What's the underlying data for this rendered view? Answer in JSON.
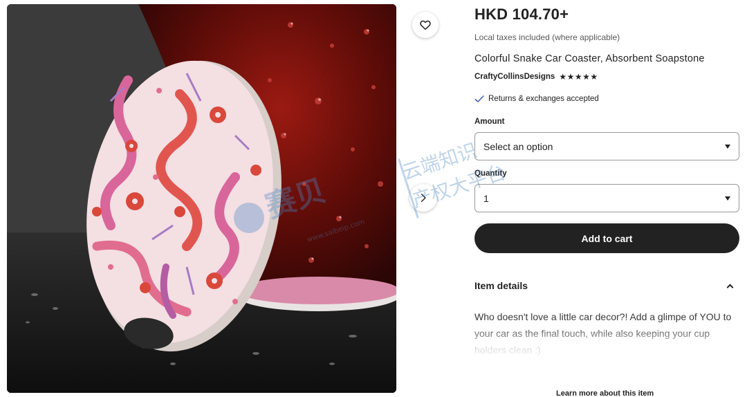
{
  "image": {
    "alt": "Colorful Snake Car Coaster",
    "favorite_icon": "heart-icon",
    "next_icon": "chevron-right-icon"
  },
  "product": {
    "price": "HKD 104.70+",
    "tax_note": "Local taxes included (where applicable)",
    "title": "Colorful Snake Car Coaster, Absorbent Soapstone",
    "shop_name": "CraftyCollinsDesigns",
    "rating_stars": "★★★★★",
    "rating_value": 5,
    "returns_text": "Returns & exchanges accepted"
  },
  "options": {
    "amount_label": "Amount",
    "amount_value": "Select an option",
    "quantity_label": "Quantity",
    "quantity_value": "1"
  },
  "cart": {
    "add_label": "Add to cart"
  },
  "details": {
    "header": "Item details",
    "description": "Who doesn't love a little car decor?! Add a glimpe of YOU to your car as the final touch, while also keeping your cup holders clean :)",
    "learn_more": "Learn more about this item"
  },
  "watermark": {
    "brand": "赛贝",
    "line1": "云端知识",
    "line2": "产权大平台",
    "url": "www.saibeip.com"
  },
  "colors": {
    "accent": "#222222",
    "muted": "#595959",
    "coaster_bg": "#f4dfe3",
    "snake_pink": "#d9669a",
    "snake_red": "#e0564f",
    "flower_red": "#d9483b",
    "leaf_purple": "#a77bc4"
  }
}
